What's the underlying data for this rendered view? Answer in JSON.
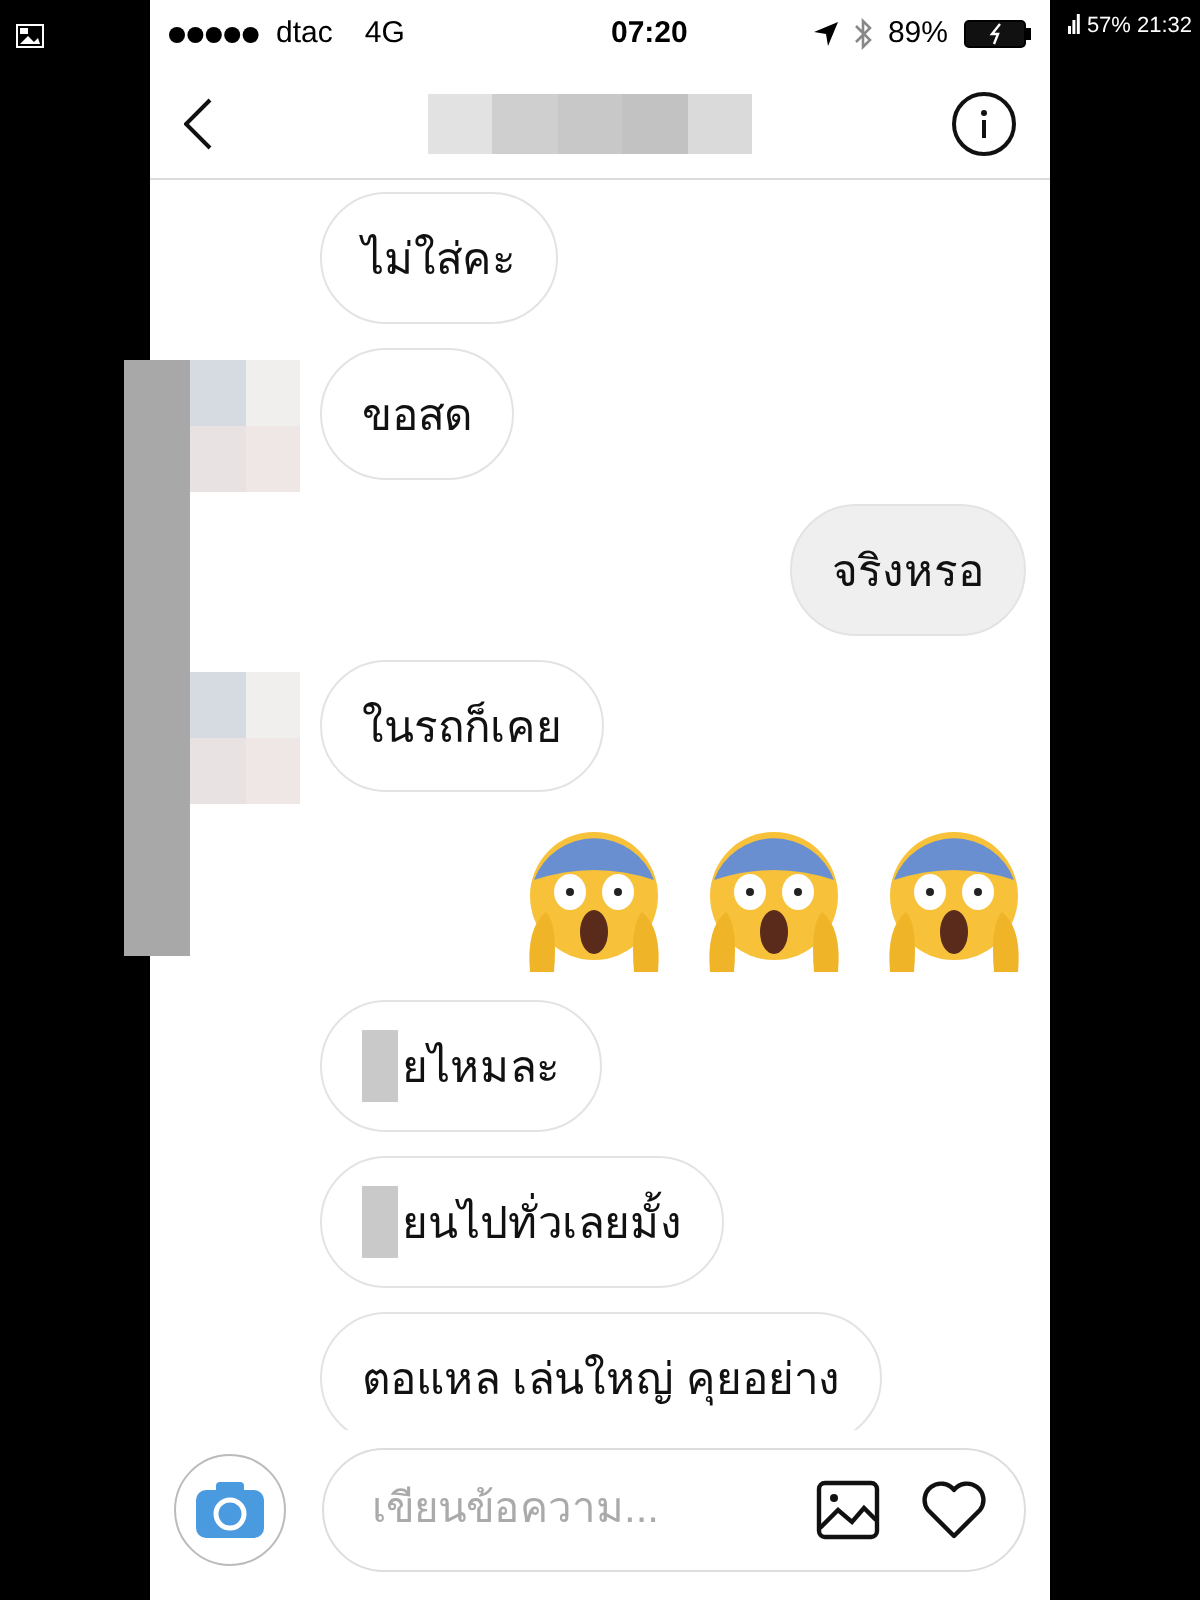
{
  "tablet_status": {
    "battery": "57%",
    "time": "21:32"
  },
  "phone_status": {
    "carrier": "dtac",
    "network": "4G",
    "time": "07:20",
    "battery": "89%"
  },
  "header": {
    "title_redacted": true
  },
  "messages": [
    {
      "kind": "incoming",
      "text": "ไม่ใส่คะ",
      "avatar_redacted": false,
      "text_redacted": false
    },
    {
      "kind": "incoming",
      "text": "ขอสด",
      "avatar_redacted": true,
      "text_redacted": false
    },
    {
      "kind": "outgoing",
      "text": "จริงหรอ",
      "avatar_redacted": false,
      "text_redacted": false
    },
    {
      "kind": "incoming",
      "text": "ในรถก็เคย",
      "avatar_redacted": true,
      "text_redacted": false
    },
    {
      "kind": "outgoing_emoji",
      "items": [
        {
          "kind": "scream"
        },
        {
          "kind": "scream"
        },
        {
          "kind": "scream"
        }
      ]
    },
    {
      "kind": "incoming",
      "text": "ยไหมละ",
      "avatar_redacted": false,
      "text_redacted": true
    },
    {
      "kind": "incoming",
      "text": "ยนไปทั่วเลยมั้ง",
      "avatar_redacted": false,
      "text_redacted": true
    },
    {
      "kind": "incoming",
      "text": "ตอแหล เล่นใหญ่ คุยอย่าง",
      "avatar_redacted": false,
      "text_redacted": false
    }
  ],
  "composer": {
    "placeholder": "เขียนข้อความ..."
  }
}
